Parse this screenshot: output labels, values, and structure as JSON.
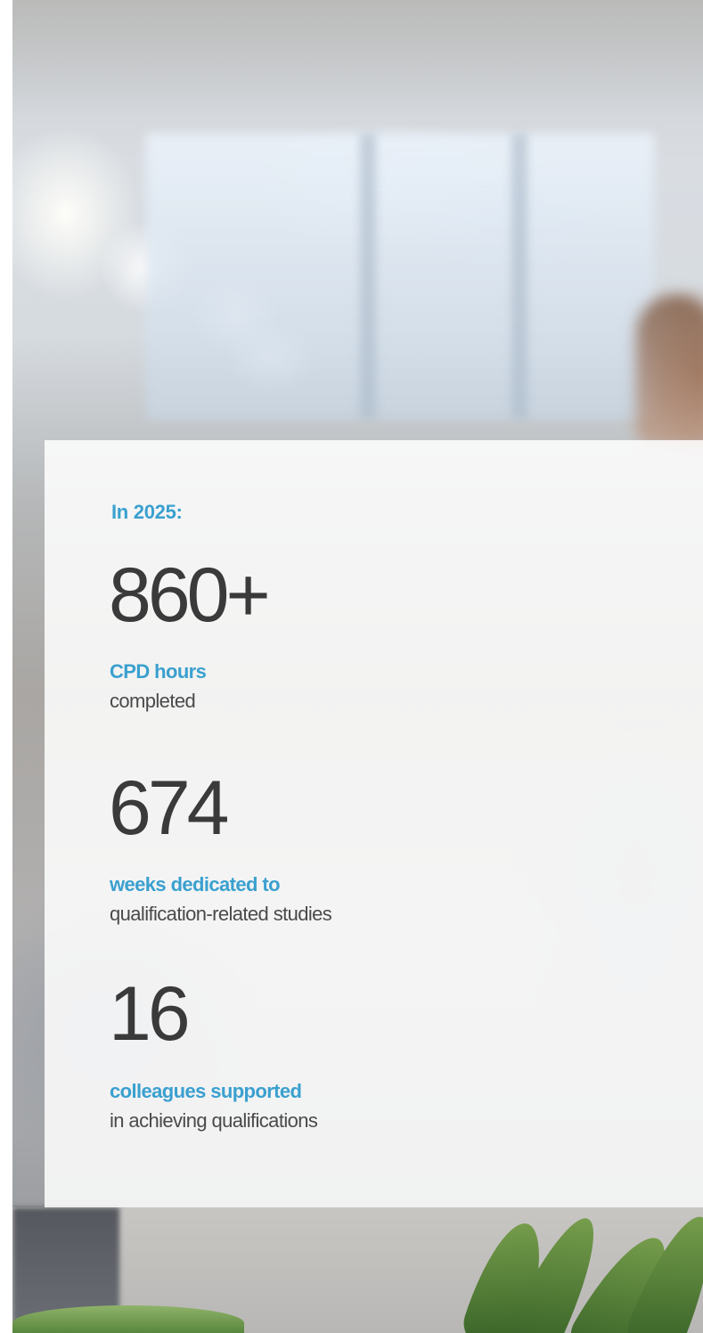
{
  "intro": "In 2025:",
  "stats": [
    {
      "value": "860+",
      "label": "CPD hours",
      "description": "completed"
    },
    {
      "value": "674",
      "label": "weeks dedicated to",
      "description": "qualification-related studies"
    },
    {
      "value": "16",
      "label": "colleagues supported",
      "description": "in achieving qualifications"
    }
  ],
  "colors": {
    "accent": "#3aa0cf",
    "number": "#3a3a3a",
    "card_background": "#ffffff"
  }
}
